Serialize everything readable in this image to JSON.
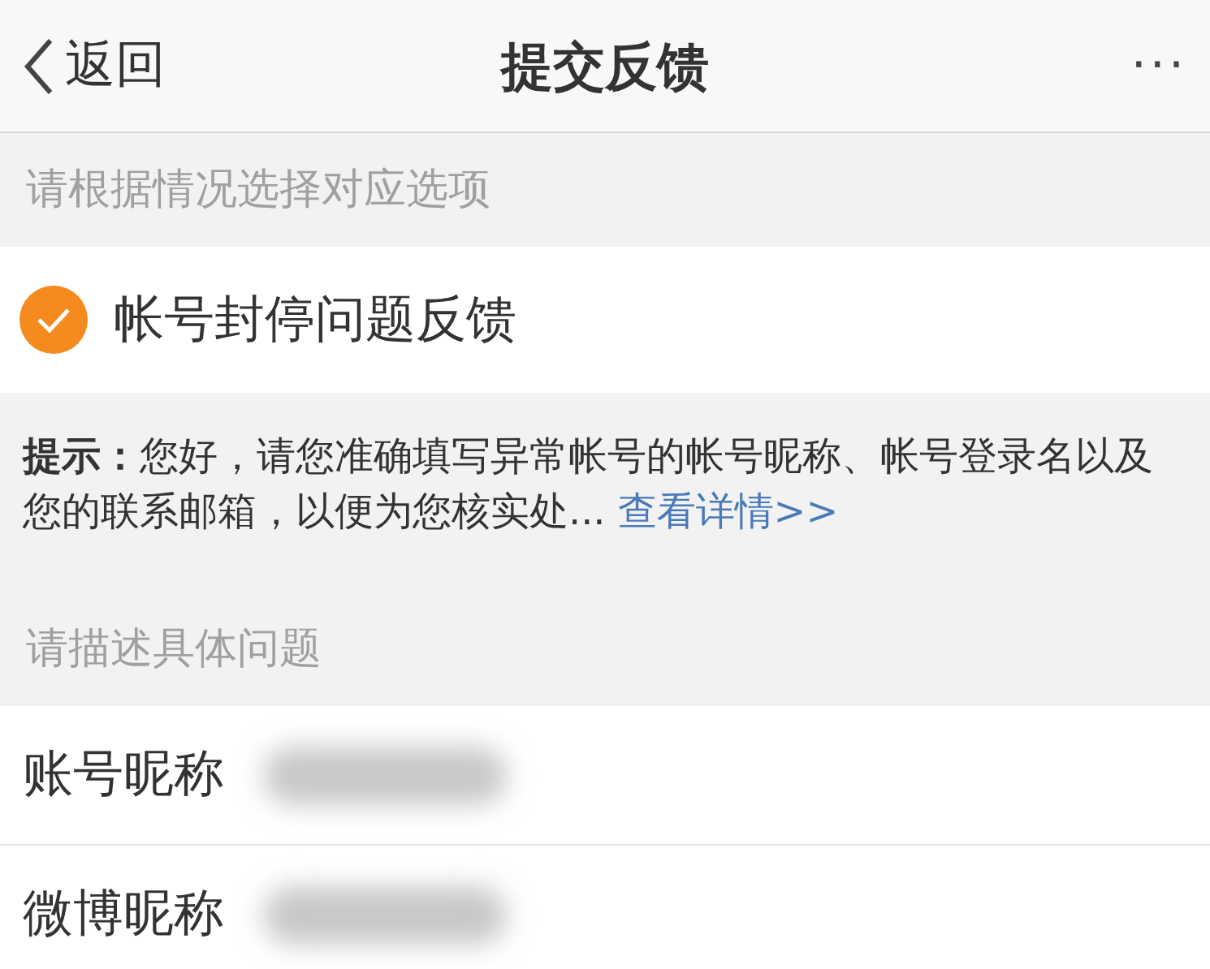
{
  "nav": {
    "back": "返回",
    "title": "提交反馈",
    "more": "···"
  },
  "sections": [
    {
      "kind": "header",
      "text": "请根据情况选择对应选项"
    },
    {
      "kind": "option",
      "label": "帐号封停问题反馈",
      "selected": true
    },
    {
      "kind": "notice",
      "text": "**提示：**您好，请您准确填写异常帐号的帐号昵称、帐号登录名以及您的联系邮箱，以便为您核实处...",
      "link": "查看详情>>"
    },
    {
      "kind": "header",
      "text": "请描述具体问题"
    },
    {
      "kind": "field",
      "label": "账号昵称",
      "value_redacted": true
    },
    {
      "kind": "field",
      "label": "微博昵称",
      "value_redacted": true
    }
  ]
}
